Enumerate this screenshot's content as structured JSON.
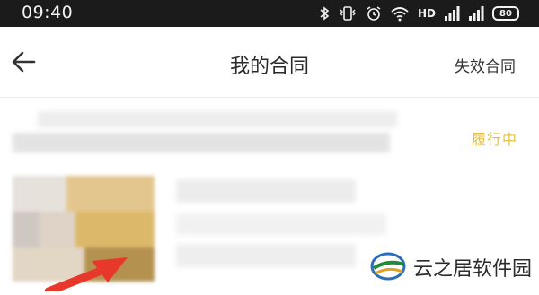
{
  "status_bar": {
    "time": "09:40",
    "network_label": "HD",
    "battery_level": "80",
    "icons": [
      "bluetooth-icon",
      "vibrate-icon",
      "alarm-icon",
      "wifi-icon",
      "signal-icon",
      "signal-icon",
      "battery-icon"
    ]
  },
  "header": {
    "back_icon": "arrow-left-icon",
    "title": "我的合同",
    "action_label": "失效合同"
  },
  "contract": {
    "status": "履行中"
  },
  "colors": {
    "status_bar_bg": "#1b1b1b",
    "status_accent": "#e5c33e",
    "arrow_red": "#e8382c"
  },
  "watermark": {
    "text": "云之居软件园",
    "logo_icon": "yunzhiju-logo-icon"
  }
}
